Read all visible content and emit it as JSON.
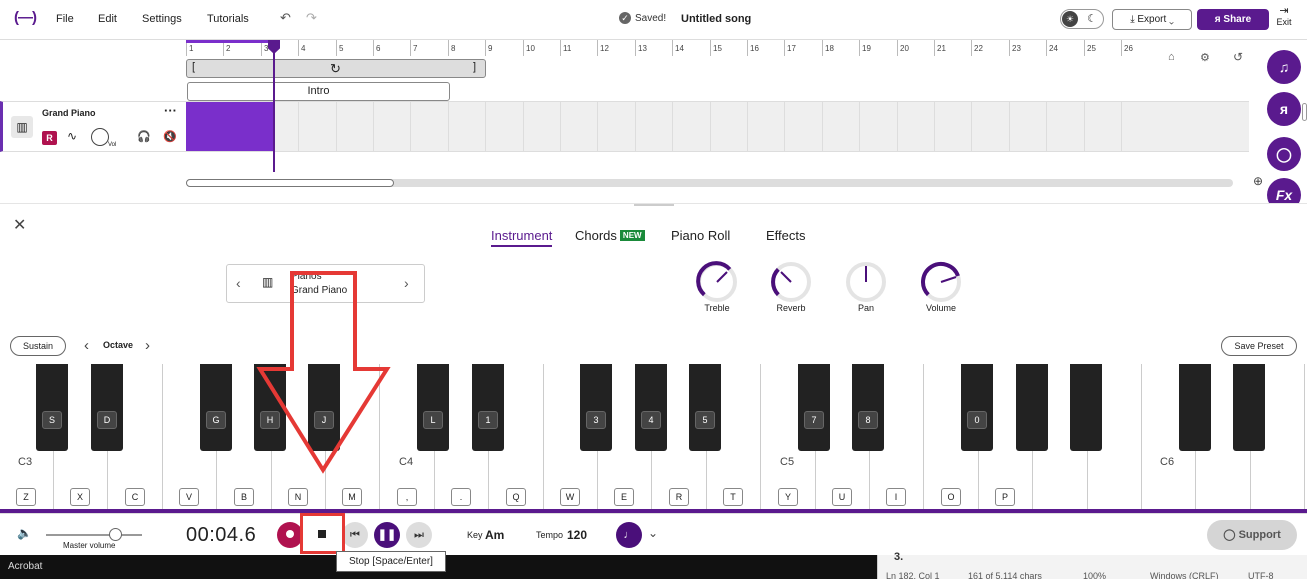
{
  "topbar": {
    "logo": "(—)",
    "menu": [
      "File",
      "Edit",
      "Settings",
      "Tutorials"
    ],
    "undo_icon": "undo-icon",
    "redo_icon": "redo-icon",
    "saved_label": "Saved!",
    "song_title": "Untitled song",
    "export_label": "Export",
    "share_label": "Share",
    "exit_label": "Exit"
  },
  "timeline": {
    "bars": [
      "1",
      "2",
      "3",
      "4",
      "5",
      "6",
      "7",
      "8",
      "9",
      "10",
      "11",
      "12",
      "13",
      "14",
      "15",
      "16",
      "17",
      "18",
      "19",
      "20",
      "21",
      "22",
      "23",
      "24",
      "25",
      "26"
    ],
    "section_label": "Intro",
    "track_name": "Grand Piano",
    "track_rec_badge": "R",
    "track_vol_label": "Vol"
  },
  "panel": {
    "tabs": [
      "Instrument",
      "Chords",
      "Piano Roll",
      "Effects"
    ],
    "new_badge": "NEW",
    "instrument_category": "Pianos",
    "instrument_name": "Grand Piano",
    "knobs": [
      "Treble",
      "Reverb",
      "Pan",
      "Volume"
    ],
    "sustain_label": "Sustain",
    "octave_label": "Octave",
    "save_preset_label": "Save Preset"
  },
  "keyboard": {
    "octave_labels": [
      "C3",
      "C4",
      "C5",
      "C6"
    ],
    "white_key_labels": [
      "Z",
      "X",
      "C",
      "V",
      "B",
      "N",
      "M",
      ",",
      ".",
      "Q",
      "W",
      "E",
      "R",
      "T",
      "Y",
      "U",
      "I",
      "O",
      "P"
    ],
    "black_key_labels": [
      "S",
      "D",
      "G",
      "H",
      "J",
      "L",
      "1",
      "3",
      "4",
      "5",
      "7",
      "8",
      "0"
    ]
  },
  "transport": {
    "master_volume_label": "Master volume",
    "time": "00:04.6",
    "key_label": "Key",
    "key_value": "Am",
    "tempo_label": "Tempo",
    "tempo_value": "120",
    "support_label": "Support",
    "tooltip": "Stop [Space/Enter]"
  },
  "background": {
    "left_text": "Acrobat",
    "right_text": "3.",
    "status_fragments": [
      "Ln 182, Col 1",
      "161 of 5,114 chars",
      "100%",
      "Windows (CRLF)",
      "UTF-8"
    ]
  },
  "colors": {
    "brand": "#5a1a8e",
    "clip": "#7a2fcb",
    "record": "#b0124f",
    "annotation": "#e53935"
  }
}
